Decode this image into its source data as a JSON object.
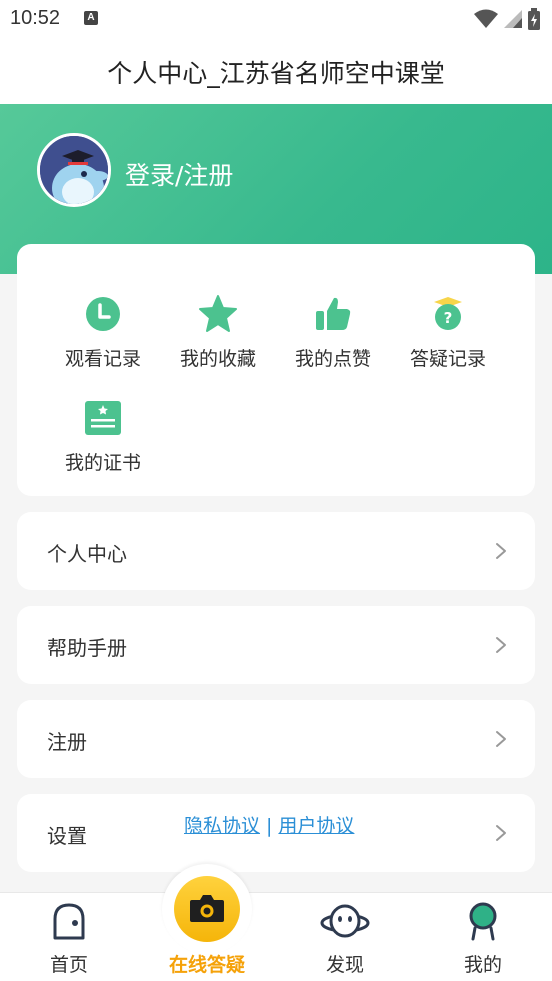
{
  "status_bar": {
    "time": "10:52",
    "notification_badge": "A"
  },
  "title": "个人中心_江苏省名师空中课堂",
  "profile": {
    "login_label": "登录/注册"
  },
  "quick_items": [
    {
      "label": "观看记录",
      "icon": "clock-icon"
    },
    {
      "label": "我的收藏",
      "icon": "star-icon"
    },
    {
      "label": "我的点赞",
      "icon": "thumbs-up-icon"
    },
    {
      "label": "答疑记录",
      "icon": "question-cap-icon"
    },
    {
      "label": "我的证书",
      "icon": "certificate-icon"
    }
  ],
  "menu": [
    {
      "label": "个人中心"
    },
    {
      "label": "帮助手册"
    },
    {
      "label": "注册"
    },
    {
      "label": "设置"
    }
  ],
  "links": {
    "privacy": "隐私协议",
    "separator": "|",
    "user_agreement": "用户协议"
  },
  "bottom_nav": {
    "home": "首页",
    "online_qa": "在线答疑",
    "discover": "发现",
    "mine": "我的"
  },
  "colors": {
    "brand_green": "#3cbb8f",
    "accent_yellow": "#f5a20a",
    "link_blue": "#2b8fd6"
  }
}
